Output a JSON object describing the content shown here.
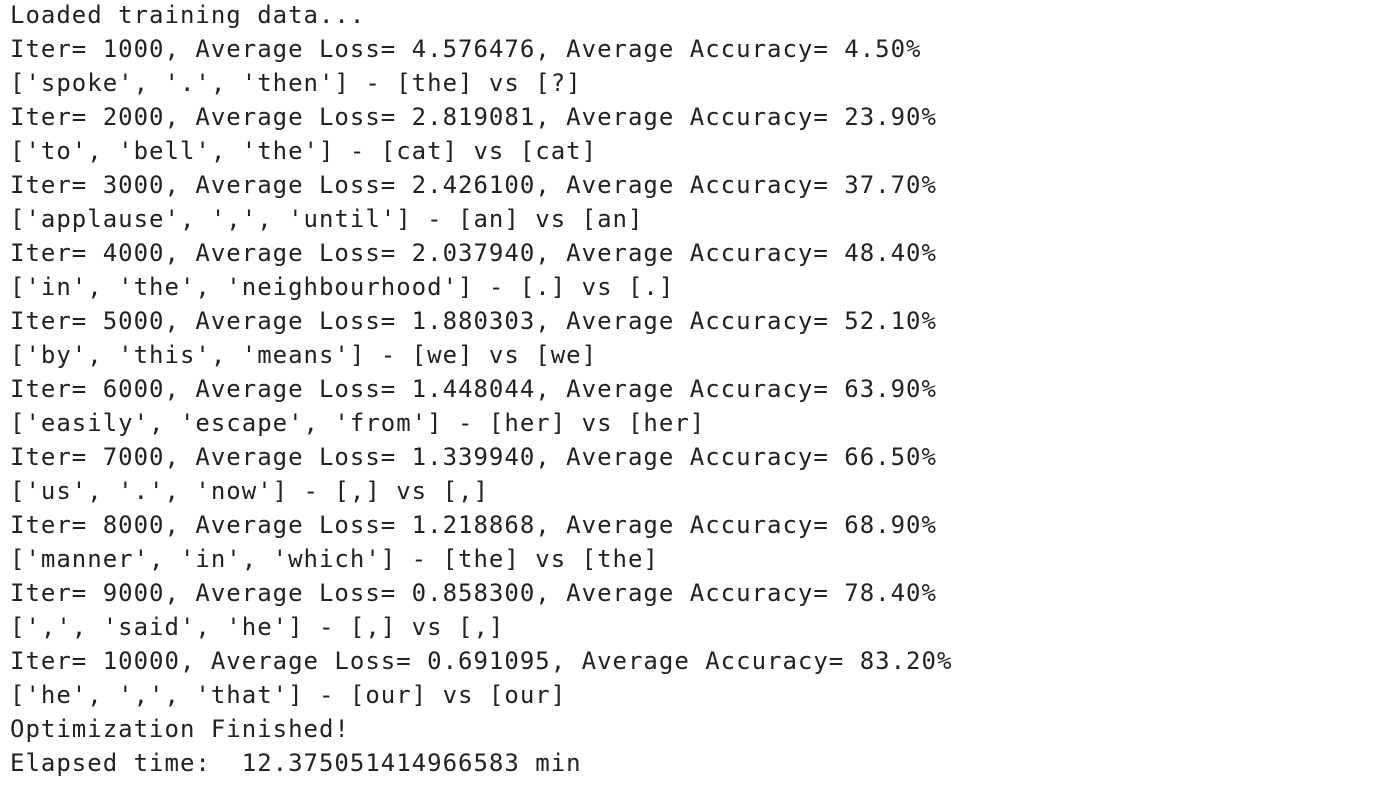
{
  "output": {
    "lines": [
      "Loaded training data...",
      "Iter= 1000, Average Loss= 4.576476, Average Accuracy= 4.50%",
      "['spoke', '.', 'then'] - [the] vs [?]",
      "Iter= 2000, Average Loss= 2.819081, Average Accuracy= 23.90%",
      "['to', 'bell', 'the'] - [cat] vs [cat]",
      "Iter= 3000, Average Loss= 2.426100, Average Accuracy= 37.70%",
      "['applause', ',', 'until'] - [an] vs [an]",
      "Iter= 4000, Average Loss= 2.037940, Average Accuracy= 48.40%",
      "['in', 'the', 'neighbourhood'] - [.] vs [.]",
      "Iter= 5000, Average Loss= 1.880303, Average Accuracy= 52.10%",
      "['by', 'this', 'means'] - [we] vs [we]",
      "Iter= 6000, Average Loss= 1.448044, Average Accuracy= 63.90%",
      "['easily', 'escape', 'from'] - [her] vs [her]",
      "Iter= 7000, Average Loss= 1.339940, Average Accuracy= 66.50%",
      "['us', '.', 'now'] - [,] vs [,]",
      "Iter= 8000, Average Loss= 1.218868, Average Accuracy= 68.90%",
      "['manner', 'in', 'which'] - [the] vs [the]",
      "Iter= 9000, Average Loss= 0.858300, Average Accuracy= 78.40%",
      "[',', 'said', 'he'] - [,] vs [,]",
      "Iter= 10000, Average Loss= 0.691095, Average Accuracy= 83.20%",
      "['he', ',', 'that'] - [our] vs [our]",
      "Optimization Finished!",
      "Elapsed time:  12.375051414966583 min"
    ]
  }
}
